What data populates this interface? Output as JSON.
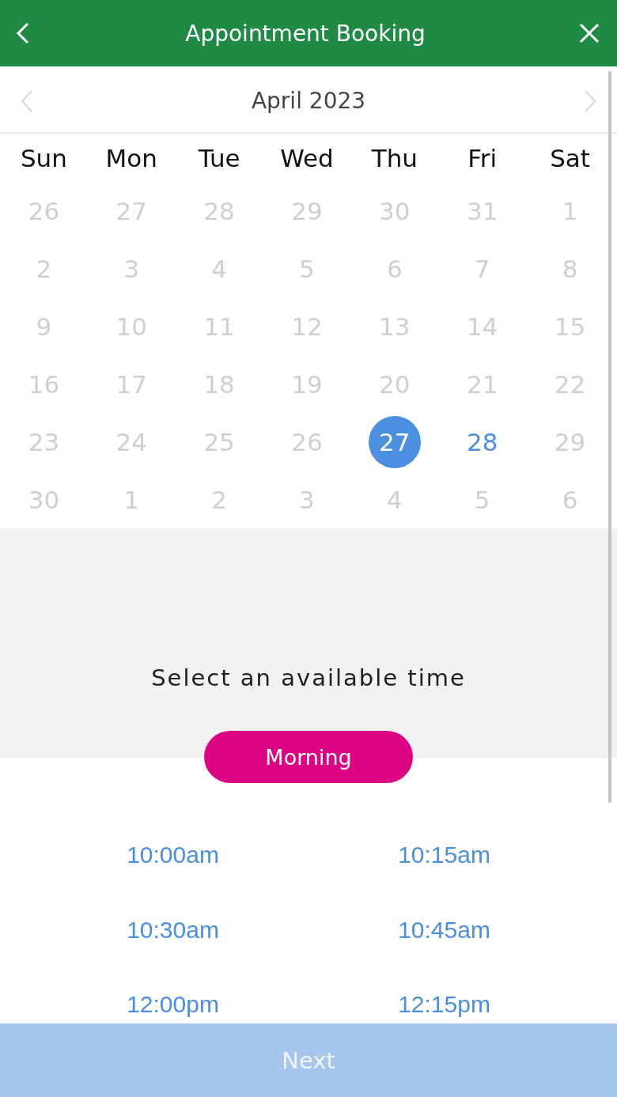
{
  "header": {
    "title": "Appointment Booking"
  },
  "calendar": {
    "month": "April 2023",
    "weekdays": [
      "Sun",
      "Mon",
      "Tue",
      "Wed",
      "Thu",
      "Fri",
      "Sat"
    ],
    "weeks": [
      [
        {
          "day": "26",
          "available": false,
          "selected": false
        },
        {
          "day": "27",
          "available": false,
          "selected": false
        },
        {
          "day": "28",
          "available": false,
          "selected": false
        },
        {
          "day": "29",
          "available": false,
          "selected": false
        },
        {
          "day": "30",
          "available": false,
          "selected": false
        },
        {
          "day": "31",
          "available": false,
          "selected": false
        },
        {
          "day": "1",
          "available": false,
          "selected": false
        }
      ],
      [
        {
          "day": "2",
          "available": false,
          "selected": false
        },
        {
          "day": "3",
          "available": false,
          "selected": false
        },
        {
          "day": "4",
          "available": false,
          "selected": false
        },
        {
          "day": "5",
          "available": false,
          "selected": false
        },
        {
          "day": "6",
          "available": false,
          "selected": false
        },
        {
          "day": "7",
          "available": false,
          "selected": false
        },
        {
          "day": "8",
          "available": false,
          "selected": false
        }
      ],
      [
        {
          "day": "9",
          "available": false,
          "selected": false
        },
        {
          "day": "10",
          "available": false,
          "selected": false
        },
        {
          "day": "11",
          "available": false,
          "selected": false
        },
        {
          "day": "12",
          "available": false,
          "selected": false
        },
        {
          "day": "13",
          "available": false,
          "selected": false
        },
        {
          "day": "14",
          "available": false,
          "selected": false
        },
        {
          "day": "15",
          "available": false,
          "selected": false
        }
      ],
      [
        {
          "day": "16",
          "available": false,
          "selected": false
        },
        {
          "day": "17",
          "available": false,
          "selected": false
        },
        {
          "day": "18",
          "available": false,
          "selected": false
        },
        {
          "day": "19",
          "available": false,
          "selected": false
        },
        {
          "day": "20",
          "available": false,
          "selected": false
        },
        {
          "day": "21",
          "available": false,
          "selected": false
        },
        {
          "day": "22",
          "available": false,
          "selected": false
        }
      ],
      [
        {
          "day": "23",
          "available": false,
          "selected": false
        },
        {
          "day": "24",
          "available": false,
          "selected": false
        },
        {
          "day": "25",
          "available": false,
          "selected": false
        },
        {
          "day": "26",
          "available": false,
          "selected": false
        },
        {
          "day": "27",
          "available": true,
          "selected": true
        },
        {
          "day": "28",
          "available": true,
          "selected": false
        },
        {
          "day": "29",
          "available": false,
          "selected": false
        }
      ],
      [
        {
          "day": "30",
          "available": false,
          "selected": false
        },
        {
          "day": "1",
          "available": false,
          "selected": false
        },
        {
          "day": "2",
          "available": false,
          "selected": false
        },
        {
          "day": "3",
          "available": false,
          "selected": false
        },
        {
          "day": "4",
          "available": false,
          "selected": false
        },
        {
          "day": "5",
          "available": false,
          "selected": false
        },
        {
          "day": "6",
          "available": false,
          "selected": false
        }
      ]
    ]
  },
  "time_panel": {
    "title": "Select an available time",
    "period": "Morning",
    "slots": [
      "10:00am",
      "10:15am",
      "10:30am",
      "10:45am",
      "12:00pm",
      "12:15pm"
    ]
  },
  "next_button": {
    "label": "Next",
    "disabled": true
  }
}
